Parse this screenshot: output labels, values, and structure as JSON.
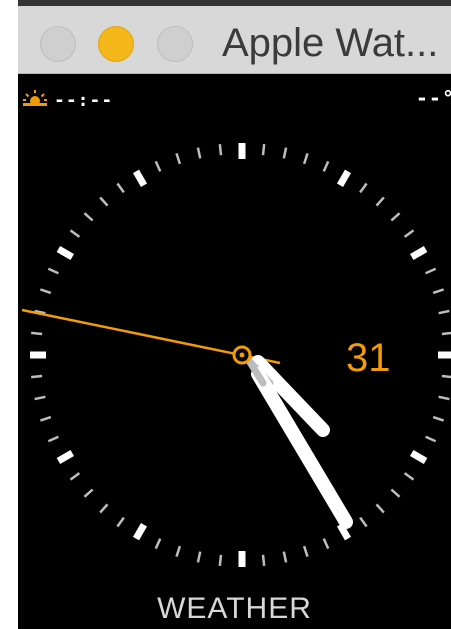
{
  "window": {
    "title": "Apple Wat..."
  },
  "status": {
    "sunrise_icon": "sunrise-icon",
    "time": "--:--",
    "temperature": "--°"
  },
  "watch_face": {
    "date": "31",
    "complication_label": "WEATHER",
    "accent_color": "#f39a0a"
  }
}
